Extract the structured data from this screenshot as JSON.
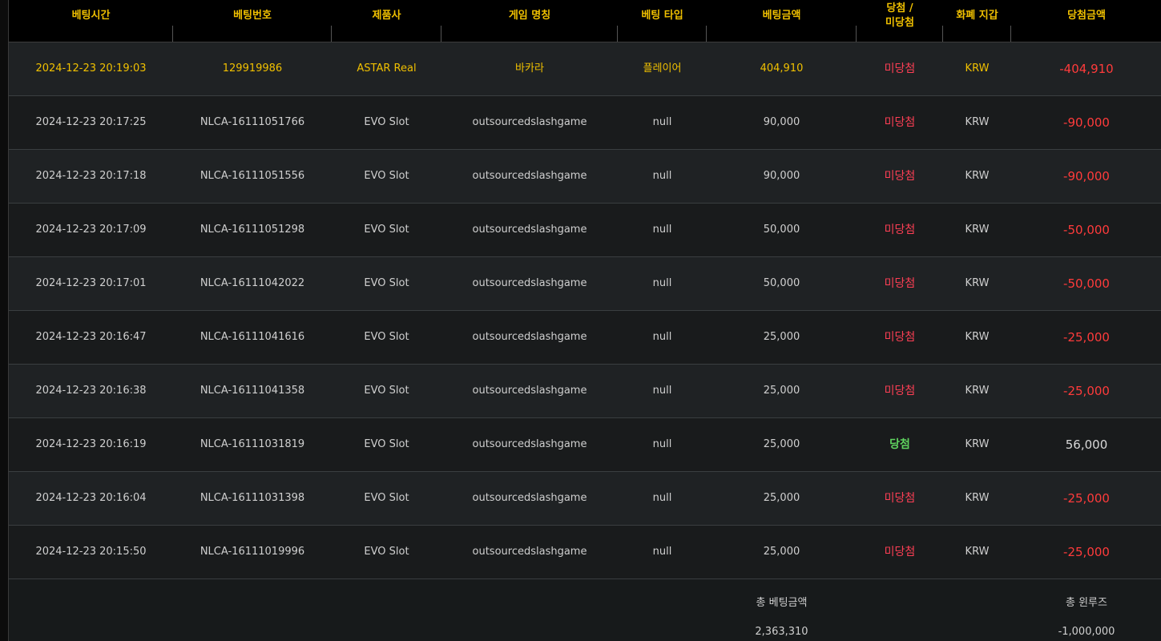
{
  "table": {
    "headers": {
      "bet_time": "베팅시간",
      "bet_number": "베팅번호",
      "provider": "제품사",
      "game_name": "게임 명칭",
      "bet_type": "베팅 타입",
      "bet_amount": "베팅금액",
      "result_line1": "당첨 /",
      "result_line2": "미당첨",
      "currency": "화폐 지갑",
      "win_amount": "당첨금액"
    },
    "rows": [
      {
        "time": "2024-12-23 20:19:03",
        "number": "129919986",
        "provider": "ASTAR Real",
        "game": "바카라",
        "type": "플레이어",
        "amount": "404,910",
        "result": "미당첨",
        "currency": "KRW",
        "win": "-404,910"
      },
      {
        "time": "2024-12-23 20:17:25",
        "number": "NLCA-16111051766",
        "provider": "EVO Slot",
        "game": "outsourcedslashgame",
        "type": "null",
        "amount": "90,000",
        "result": "미당첨",
        "currency": "KRW",
        "win": "-90,000"
      },
      {
        "time": "2024-12-23 20:17:18",
        "number": "NLCA-16111051556",
        "provider": "EVO Slot",
        "game": "outsourcedslashgame",
        "type": "null",
        "amount": "90,000",
        "result": "미당첨",
        "currency": "KRW",
        "win": "-90,000"
      },
      {
        "time": "2024-12-23 20:17:09",
        "number": "NLCA-16111051298",
        "provider": "EVO Slot",
        "game": "outsourcedslashgame",
        "type": "null",
        "amount": "50,000",
        "result": "미당첨",
        "currency": "KRW",
        "win": "-50,000"
      },
      {
        "time": "2024-12-23 20:17:01",
        "number": "NLCA-16111042022",
        "provider": "EVO Slot",
        "game": "outsourcedslashgame",
        "type": "null",
        "amount": "50,000",
        "result": "미당첨",
        "currency": "KRW",
        "win": "-50,000"
      },
      {
        "time": "2024-12-23 20:16:47",
        "number": "NLCA-16111041616",
        "provider": "EVO Slot",
        "game": "outsourcedslashgame",
        "type": "null",
        "amount": "25,000",
        "result": "미당첨",
        "currency": "KRW",
        "win": "-25,000"
      },
      {
        "time": "2024-12-23 20:16:38",
        "number": "NLCA-16111041358",
        "provider": "EVO Slot",
        "game": "outsourcedslashgame",
        "type": "null",
        "amount": "25,000",
        "result": "미당첨",
        "currency": "KRW",
        "win": "-25,000"
      },
      {
        "time": "2024-12-23 20:16:19",
        "number": "NLCA-16111031819",
        "provider": "EVO Slot",
        "game": "outsourcedslashgame",
        "type": "null",
        "amount": "25,000",
        "result": "당첨",
        "currency": "KRW",
        "win": "56,000"
      },
      {
        "time": "2024-12-23 20:16:04",
        "number": "NLCA-16111031398",
        "provider": "EVO Slot",
        "game": "outsourcedslashgame",
        "type": "null",
        "amount": "25,000",
        "result": "미당첨",
        "currency": "KRW",
        "win": "-25,000"
      },
      {
        "time": "2024-12-23 20:15:50",
        "number": "NLCA-16111019996",
        "provider": "EVO Slot",
        "game": "outsourcedslashgame",
        "type": "null",
        "amount": "25,000",
        "result": "미당첨",
        "currency": "KRW",
        "win": "-25,000"
      }
    ]
  },
  "summary": {
    "total_bet_label": "총 베팅금액",
    "total_bet_value": "2,363,310",
    "total_winloss_label": "총 윈루즈",
    "total_winloss_value": "-1,000,000"
  },
  "colors": {
    "header_text": "#f0c000",
    "lose": "#ff3f55",
    "win": "#5fd35f",
    "negative_amount": "#ff3b3b"
  }
}
